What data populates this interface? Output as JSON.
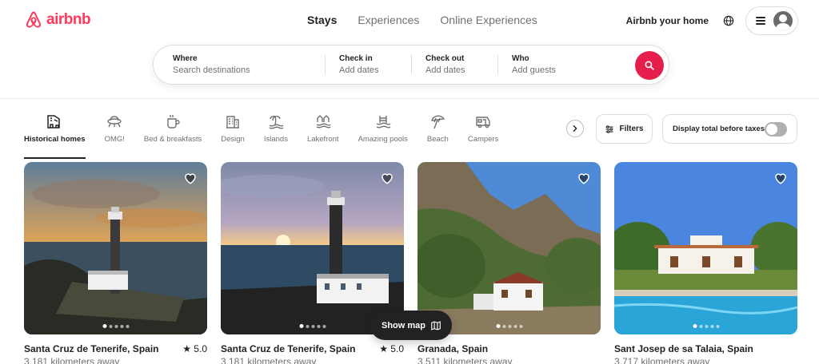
{
  "brand": {
    "name": "airbnb",
    "color": "#FF385C"
  },
  "nav": {
    "tabs": [
      {
        "label": "Stays"
      },
      {
        "label": "Experiences"
      },
      {
        "label": "Online Experiences"
      }
    ],
    "host_link": "Airbnb your home"
  },
  "search": {
    "where_label": "Where",
    "where_placeholder": "Search destinations",
    "checkin_label": "Check in",
    "checkin_placeholder": "Add dates",
    "checkout_label": "Check out",
    "checkout_placeholder": "Add dates",
    "who_label": "Who",
    "who_placeholder": "Add guests",
    "button_color": "#E61E4D"
  },
  "categories": [
    {
      "label": "Historical homes",
      "icon": "historical-homes-icon"
    },
    {
      "label": "OMG!",
      "icon": "ufo-icon"
    },
    {
      "label": "Bed & breakfasts",
      "icon": "coffee-icon"
    },
    {
      "label": "Design",
      "icon": "building-icon"
    },
    {
      "label": "Islands",
      "icon": "island-icon"
    },
    {
      "label": "Lakefront",
      "icon": "lakefront-icon"
    },
    {
      "label": "Amazing pools",
      "icon": "pool-icon"
    },
    {
      "label": "Beach",
      "icon": "umbrella-icon"
    },
    {
      "label": "Campers",
      "icon": "camper-icon"
    }
  ],
  "filters": {
    "label": "Filters"
  },
  "tax_toggle": {
    "label": "Display total before taxes",
    "on": false
  },
  "listings": [
    {
      "title": "Santa Cruz de Tenerife, Spain",
      "rating": "★ 5.0",
      "distance": "3,181 kilometers away"
    },
    {
      "title": "Santa Cruz de Tenerife, Spain",
      "rating": "★ 5.0",
      "distance": "3,181 kilometers away"
    },
    {
      "title": "Granada, Spain",
      "rating": "",
      "distance": "3,511 kilometers away"
    },
    {
      "title": "Sant Josep de sa Talaia, Spain",
      "rating": "",
      "distance": "3,717 kilometers away"
    }
  ],
  "show_map": {
    "label": "Show map"
  }
}
